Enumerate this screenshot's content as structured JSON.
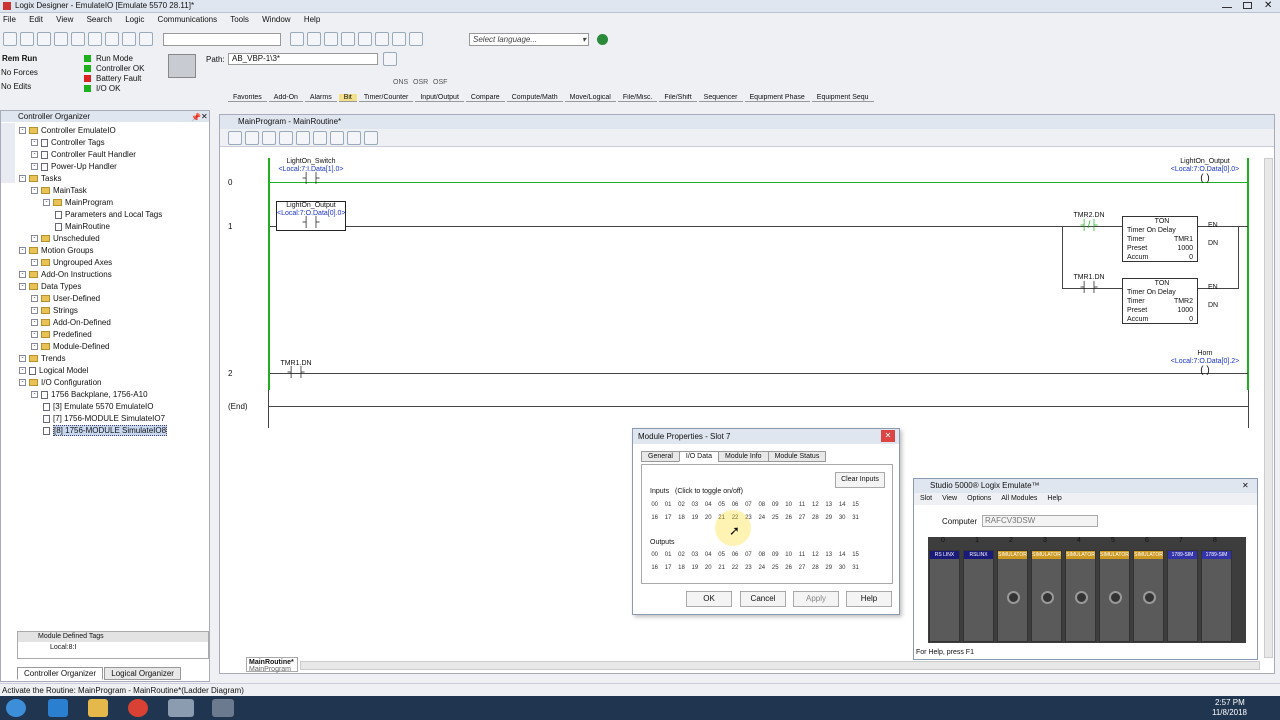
{
  "window": {
    "title": "Logix Designer - EmulateIO [Emulate 5570 28.11]*"
  },
  "menu": [
    "File",
    "Edit",
    "View",
    "Search",
    "Logic",
    "Communications",
    "Tools",
    "Window",
    "Help"
  ],
  "toolbar": {
    "language_placeholder": "Select language...",
    "path_label": "Path:",
    "path_value": "AB_VBP-1\\3*"
  },
  "status": {
    "mode": "Rem Run",
    "forces": "No Forces",
    "edits": "No Edits",
    "run_mode": "Run Mode",
    "controller_ok": "Controller OK",
    "battery": "Battery Fault",
    "io_ok": "I/O OK"
  },
  "instr_tabs": [
    "Favorites",
    "Add-On",
    "Alarms",
    "Bit",
    "Timer/Counter",
    "Input/Output",
    "Compare",
    "Compute/Math",
    "Move/Logical",
    "File/Misc.",
    "File/Shift",
    "Sequencer",
    "Equipment Phase",
    "Equipment Sequ"
  ],
  "instr_tabs_active": "Bit",
  "instr_symbols": [
    "ONS",
    "OSR",
    "OSF"
  ],
  "organizer": {
    "title": "Controller Organizer",
    "tree": [
      "Controller EmulateIO",
      "Controller Tags",
      "Controller Fault Handler",
      "Power-Up Handler",
      "Tasks",
      "MainTask",
      "MainProgram",
      "Parameters and Local Tags",
      "MainRoutine",
      "Unscheduled",
      "Motion Groups",
      "Ungrouped Axes",
      "Add-On Instructions",
      "Data Types",
      "User-Defined",
      "Strings",
      "Add-On-Defined",
      "Predefined",
      "Module-Defined",
      "Trends",
      "Logical Model",
      "I/O Configuration",
      "1756 Backplane, 1756-A10",
      "[3] Emulate 5570 EmulateIO",
      "[7] 1756-MODULE SimulateIO7",
      "[8] 1756-MODULE SimulateIO8"
    ],
    "bottom_title": "Module Defined Tags",
    "bottom_item": "Local:8:I",
    "tabs": [
      "Controller Organizer",
      "Logical Organizer"
    ]
  },
  "routine": {
    "title": "MainProgram - MainRoutine*",
    "tab": "MainRoutine*",
    "tab_sub": "MainProgram",
    "rungs": [
      "0",
      "1",
      "2",
      "(End)"
    ],
    "r0_xic_name": "LightOn_Switch",
    "r0_xic_tag": "<Local:7:I.Data[1].0>",
    "r0_ote_name": "LightOn_Output",
    "r0_ote_tag": "<Local:7:O.Data[0].0>",
    "r1_xic_name": "LightOn_Output",
    "r1_xic_tag": "<Local:7:O.Data[0].0>",
    "r1_b1": "TMR2.DN",
    "r1_b2": "TMR1.DN",
    "ton1": {
      "title": "TON",
      "name": "Timer On Delay",
      "timer_l": "Timer",
      "timer_v": "TMR1",
      "preset_l": "Preset",
      "preset_v": "1000",
      "accum_l": "Accum",
      "accum_v": "0",
      "en": "EN",
      "dn": "DN"
    },
    "ton2": {
      "title": "TON",
      "name": "Timer On Delay",
      "timer_l": "Timer",
      "timer_v": "TMR2",
      "preset_l": "Preset",
      "preset_v": "1000",
      "accum_l": "Accum",
      "accum_v": "0",
      "en": "EN",
      "dn": "DN"
    },
    "r2_xic_name": "TMR1.DN",
    "r2_ote_name": "Horn",
    "r2_ote_tag": "<Local:7:O.Data[0].2>"
  },
  "dialog": {
    "title": "Module Properties - Slot 7",
    "tabs": [
      "General",
      "I/O Data",
      "Module Info",
      "Module Status"
    ],
    "tabs_active": "I/O Data",
    "clear_inputs": "Clear Inputs",
    "inputs_label": "Inputs",
    "inputs_hint": "(Click to toggle on/off)",
    "outputs_label": "Outputs",
    "bits_row1": [
      "00",
      "01",
      "02",
      "03",
      "04",
      "05",
      "06",
      "07",
      "08",
      "09",
      "10",
      "11",
      "12",
      "13",
      "14",
      "15"
    ],
    "bits_row2": [
      "16",
      "17",
      "18",
      "19",
      "20",
      "21",
      "22",
      "23",
      "24",
      "25",
      "26",
      "27",
      "28",
      "29",
      "30",
      "31"
    ],
    "buttons": {
      "ok": "OK",
      "cancel": "Cancel",
      "apply": "Apply",
      "help": "Help"
    }
  },
  "emulate": {
    "title": "Studio 5000® Logix Emulate™",
    "menu": [
      "Slot",
      "View",
      "Options",
      "All Modules",
      "Help"
    ],
    "computer_label": "Computer",
    "computer_value": "RAFCV3DSW",
    "slots": [
      "0",
      "1",
      "2",
      "3",
      "4",
      "5",
      "6",
      "7",
      "8"
    ],
    "slot_labels": [
      "RS LINX",
      "RSLINX",
      "SIMULATOR",
      "SIMULATOR",
      "SIMULATOR",
      "SIMULATOR",
      "SIMULATOR",
      "1789-SIM",
      "1789-SIM"
    ],
    "status": "For Help, press F1"
  },
  "statusbar": "Activate the Routine: MainProgram - MainRoutine*(Ladder Diagram)",
  "clock": {
    "time": "2:57 PM",
    "date": "11/8/2018"
  },
  "colors": {
    "titlebar": "#dfe6ef",
    "accent": "#1a32c8",
    "rung_green": "#1fb01f",
    "tab_yellow": "#f3e08a"
  }
}
